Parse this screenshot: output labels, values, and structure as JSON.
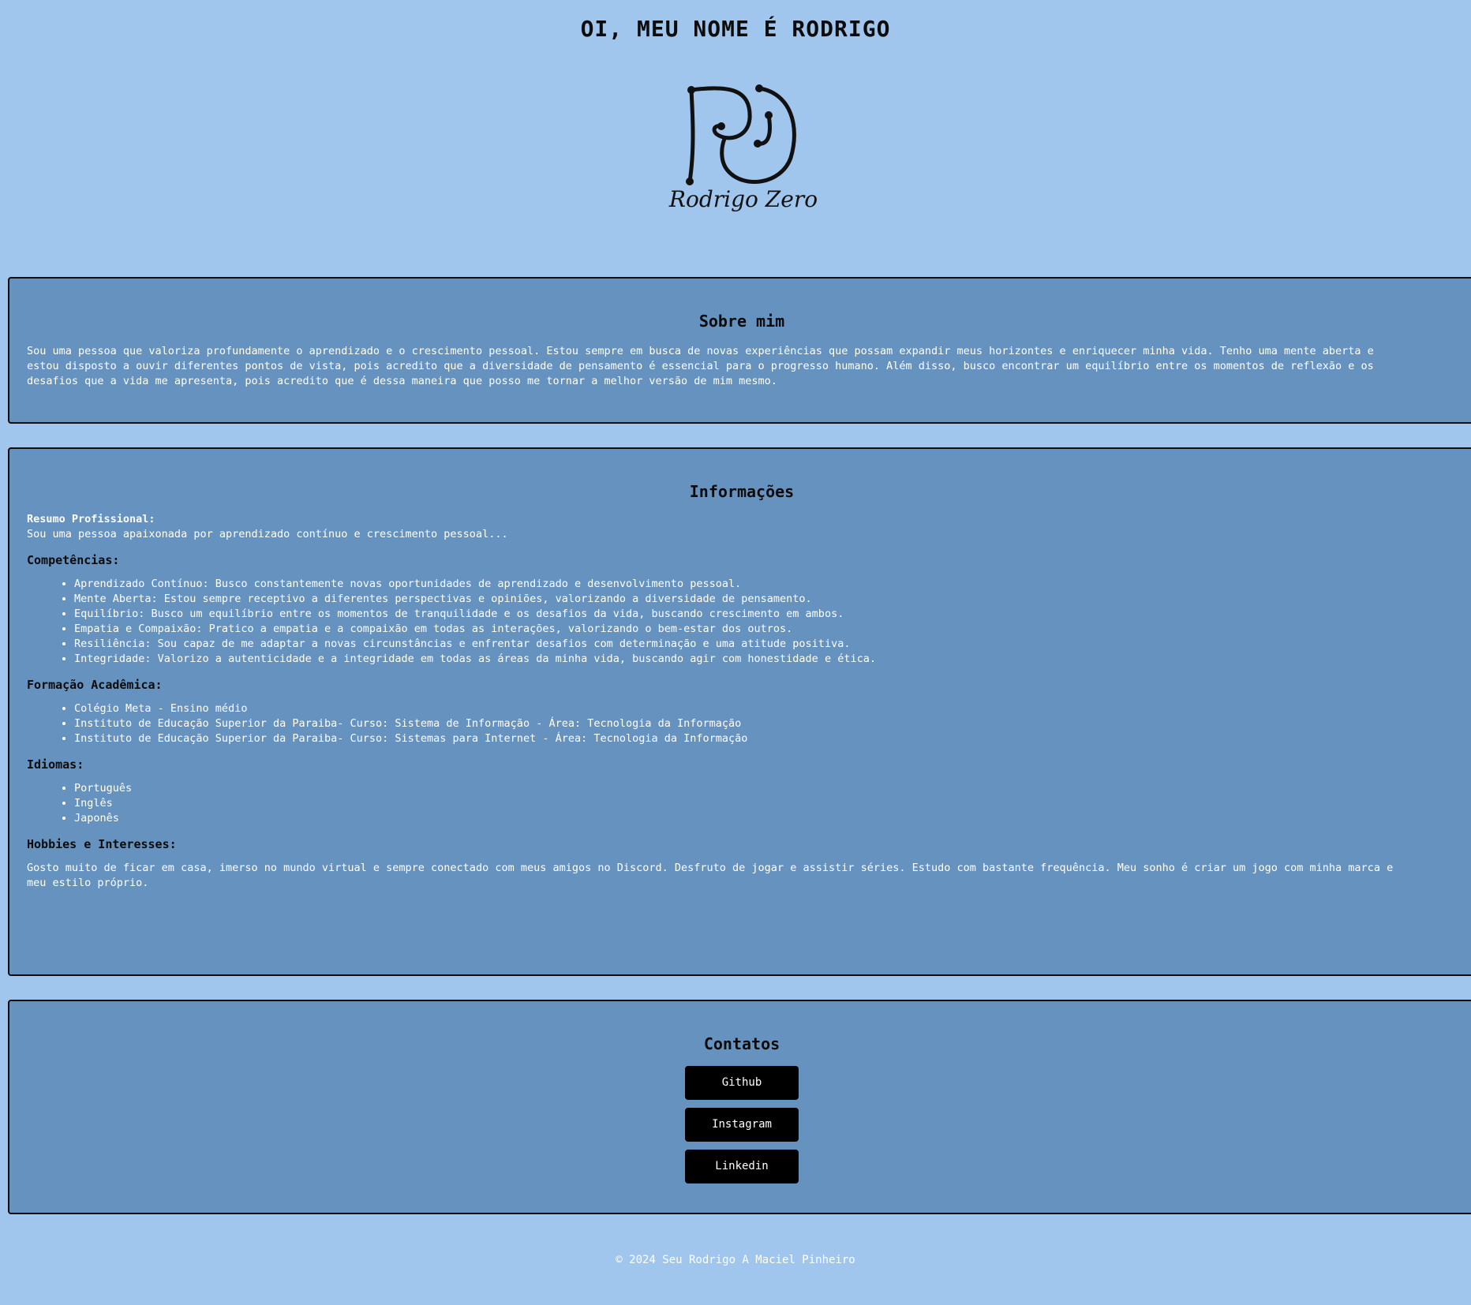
{
  "header": {
    "title": "OI, MEU NOME É RODRIGO",
    "logo_text": "Rodrigo Zero"
  },
  "about": {
    "heading": "Sobre mim",
    "text": "Sou uma pessoa que valoriza profundamente o aprendizado e o crescimento pessoal. Estou sempre em busca de novas experiências que possam expandir meus horizontes e enriquecer minha vida. Tenho uma mente aberta e estou disposto a ouvir diferentes pontos de vista, pois acredito que a diversidade de pensamento é essencial para o progresso humano. Além disso, busco encontrar um equilíbrio entre os momentos de reflexão e os desafios que a vida me apresenta, pois acredito que é dessa maneira que posso me tornar a melhor versão de mim mesmo."
  },
  "info": {
    "heading": "Informações",
    "summary_label": "Resumo Profissional:",
    "summary_text": "Sou uma pessoa apaixonada por aprendizado contínuo e crescimento pessoal...",
    "skills_heading": "Competências:",
    "skills": [
      "Aprendizado Contínuo: Busco constantemente novas oportunidades de aprendizado e desenvolvimento pessoal.",
      "Mente Aberta: Estou sempre receptivo a diferentes perspectivas e opiniões, valorizando a diversidade de pensamento.",
      "Equilíbrio: Busco um equilíbrio entre os momentos de tranquilidade e os desafios da vida, buscando crescimento em ambos.",
      "Empatia e Compaixão: Pratico a empatia e a compaixão em todas as interações, valorizando o bem-estar dos outros.",
      "Resiliência: Sou capaz de me adaptar a novas circunstâncias e enfrentar desafios com determinação e uma atitude positiva.",
      "Integridade: Valorizo a autenticidade e a integridade em todas as áreas da minha vida, buscando agir com honestidade e ética."
    ],
    "education_heading": "Formação Acadêmica:",
    "education": [
      "Colégio Meta - Ensino médio",
      "Instituto de Educação Superior da Paraiba- Curso: Sistema de Informação - Área: Tecnologia da Informação",
      "Instituto de Educação Superior da Paraiba- Curso: Sistemas para Internet - Área: Tecnologia da Informação"
    ],
    "languages_heading": "Idiomas:",
    "languages": [
      "Português",
      "Inglês",
      "Japonês"
    ],
    "hobbies_heading": "Hobbies e Interesses:",
    "hobbies_text": "Gosto muito de ficar em casa, imerso no mundo virtual e sempre conectado com meus amigos no Discord. Desfruto de jogar e assistir séries. Estudo com bastante frequência. Meu sonho é criar um jogo com minha marca e meu estilo próprio."
  },
  "contacts": {
    "heading": "Contatos",
    "github": "Github",
    "instagram": "Instagram",
    "linkedin": "Linkedin"
  },
  "footer": {
    "text": "© 2024 Seu Rodrigo A Maciel Pinheiro"
  },
  "colors": {
    "page_background": "#a0c6ee",
    "section_background": "#6692bf",
    "button_background": "#000000"
  }
}
